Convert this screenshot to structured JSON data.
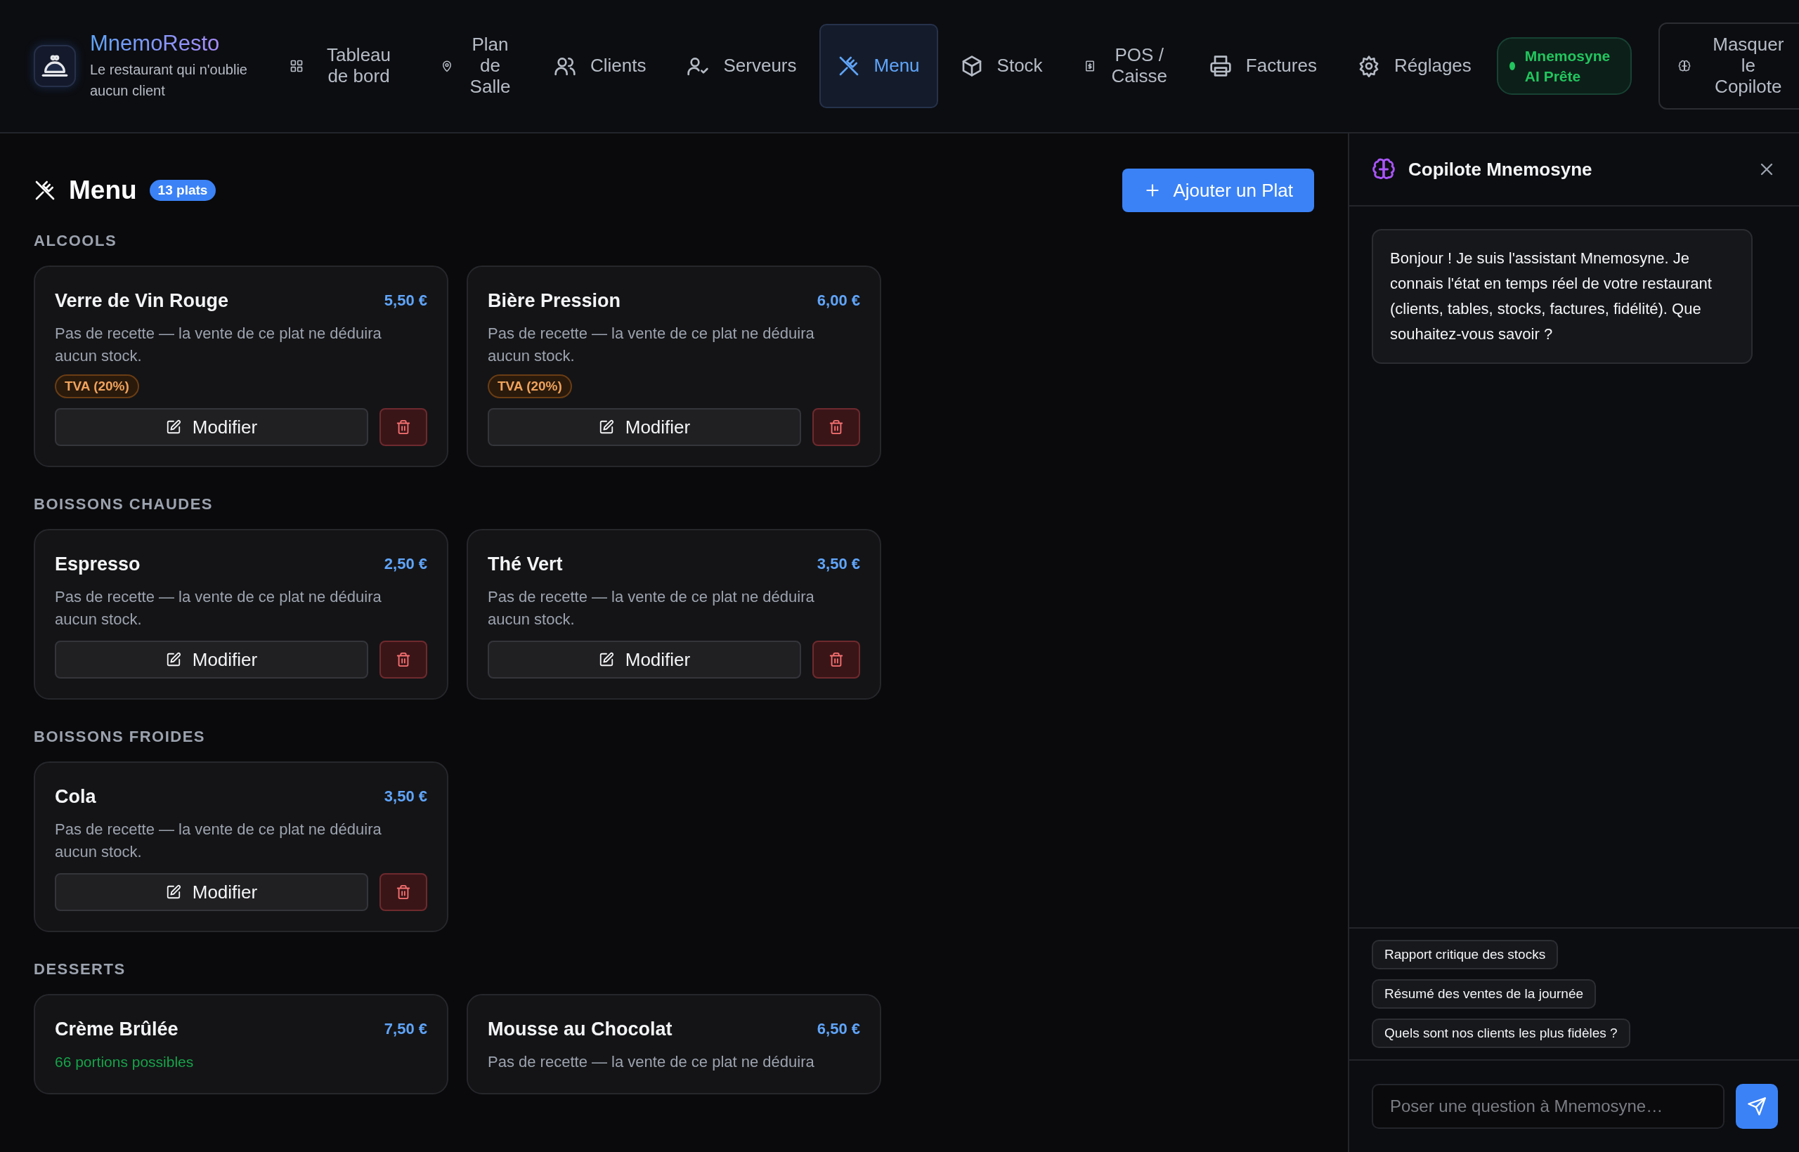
{
  "brand": {
    "name": "MnemoResto",
    "tagline": "Le restaurant qui n'oublie aucun client"
  },
  "nav": [
    {
      "label": "Tableau de bord",
      "selected": false
    },
    {
      "label": "Plan de Salle",
      "selected": false
    },
    {
      "label": "Clients",
      "selected": false
    },
    {
      "label": "Serveurs",
      "selected": false
    },
    {
      "label": "Menu",
      "selected": true
    },
    {
      "label": "Stock",
      "selected": false
    },
    {
      "label": "POS / Caisse",
      "selected": false
    },
    {
      "label": "Factures",
      "selected": false
    },
    {
      "label": "Réglages",
      "selected": false
    }
  ],
  "ai_status": "Mnemosyne AI Prête",
  "copilot_toggle": "Masquer le Copilote",
  "page": {
    "title": "Menu",
    "count": "13 plats",
    "add_button": "Ajouter un Plat"
  },
  "categories": [
    {
      "name": "ALCOOLS",
      "dishes": [
        {
          "name": "Verre de Vin Rouge",
          "price": "5,50 €",
          "description": "Pas de recette — la vente de ce plat ne déduira aucun stock.",
          "tax": "TVA (20%)",
          "edit": "Modifier"
        },
        {
          "name": "Bière Pression",
          "price": "6,00 €",
          "description": "Pas de recette — la vente de ce plat ne déduira aucun stock.",
          "tax": "TVA (20%)",
          "edit": "Modifier"
        }
      ]
    },
    {
      "name": "BOISSONS CHAUDES",
      "dishes": [
        {
          "name": "Espresso",
          "price": "2,50 €",
          "description": "Pas de recette — la vente de ce plat ne déduira aucun stock.",
          "edit": "Modifier"
        },
        {
          "name": "Thé Vert",
          "price": "3,50 €",
          "description": "Pas de recette — la vente de ce plat ne déduira aucun stock.",
          "edit": "Modifier"
        }
      ]
    },
    {
      "name": "BOISSONS FROIDES",
      "dishes": [
        {
          "name": "Cola",
          "price": "3,50 €",
          "description": "Pas de recette — la vente de ce plat ne déduira aucun stock.",
          "edit": "Modifier"
        }
      ]
    },
    {
      "name": "DESSERTS",
      "dishes": [
        {
          "name": "Crème Brûlée",
          "price": "7,50 €",
          "portions": "66 portions possibles"
        },
        {
          "name": "Mousse au Chocolat",
          "price": "6,50 €",
          "description": "Pas de recette — la vente de ce plat ne déduira"
        }
      ]
    }
  ],
  "copilot": {
    "title": "Copilote Mnemosyne",
    "message": "Bonjour ! Je suis l'assistant Mnemosyne. Je connais l'état en temps réel de votre restaurant (clients, tables, stocks, factures, fidélité). Que souhaitez-vous savoir ?",
    "suggestions": [
      "Rapport critique des stocks",
      "Résumé des ventes de la journée",
      "Quels sont nos clients les plus fidèles ?"
    ],
    "placeholder": "Poser une question à Mnemosyne…"
  }
}
